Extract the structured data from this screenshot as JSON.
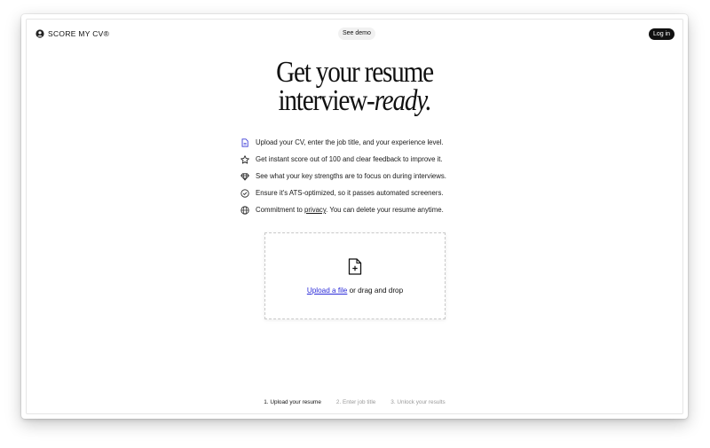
{
  "header": {
    "brand": "SCORE MY CV®",
    "demo_label": "See demo",
    "login_label": "Log in"
  },
  "hero": {
    "line1": "Get your resume",
    "line2_prefix": "interview-",
    "line2_emphasis": "ready."
  },
  "features": [
    {
      "icon": "file-icon",
      "text": "Upload your CV, enter the job title, and your experience level."
    },
    {
      "icon": "star-icon",
      "text": "Get instant score out of 100 and clear feedback to improve it."
    },
    {
      "icon": "diamond-icon",
      "text": "See what your key strengths are to focus on during interviews."
    },
    {
      "icon": "check-circle-icon",
      "text": "Ensure it's ATS-optimized, so it passes automated screeners."
    },
    {
      "icon": "globe-icon",
      "text_before": "Commitment to ",
      "link": "privacy",
      "text_after": ". You can delete your resume anytime."
    }
  ],
  "upload": {
    "link_label": "Upload a file",
    "rest_label": " or drag and drop"
  },
  "steps": [
    {
      "label": "1. Upload your resume",
      "active": true
    },
    {
      "label": "2. Enter job title",
      "active": false
    },
    {
      "label": "3. Unlock your results",
      "active": false
    }
  ],
  "colors": {
    "accent_link": "#2a2ad8",
    "icon_accent": "#3b3bd6",
    "dark": "#111111"
  }
}
